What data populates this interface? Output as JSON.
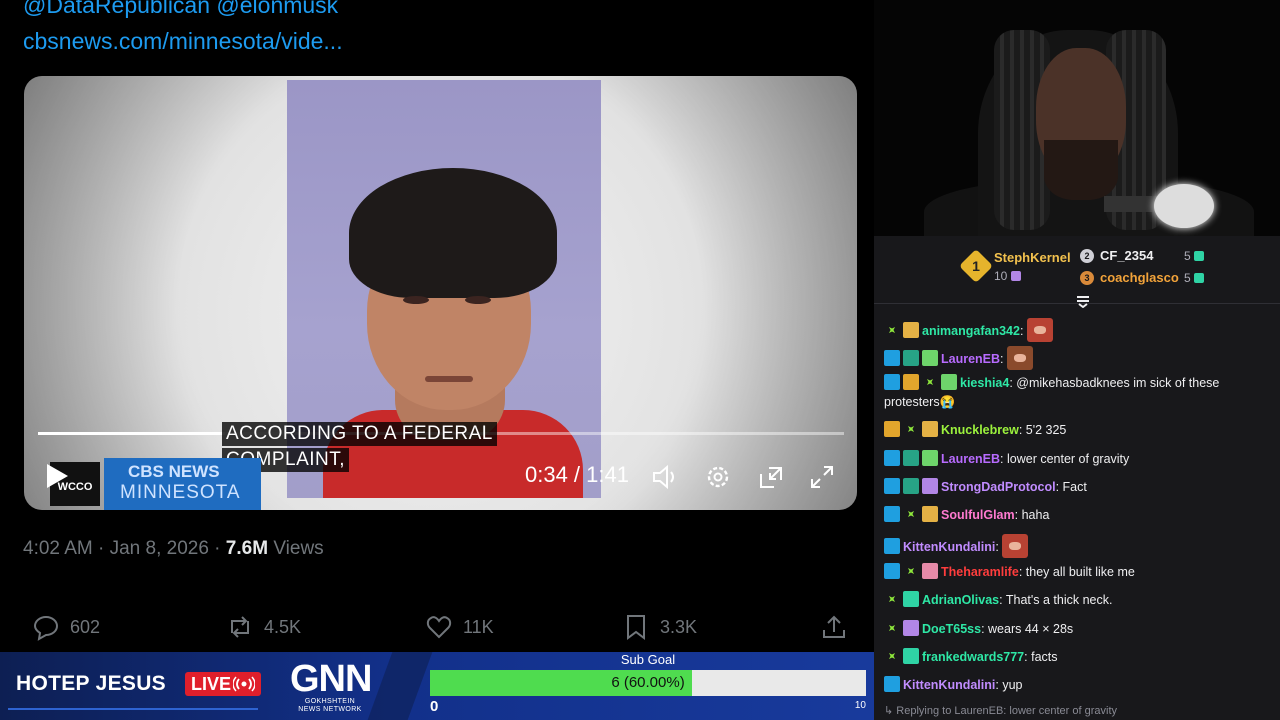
{
  "tweet": {
    "mentions": "@DataRepublican @elonmusk",
    "link": "cbsnews.com/minnesota/vide...",
    "video": {
      "caption_line1": "ACCORDING TO A FEDERAL",
      "caption_line2": "COMPLAINT,",
      "time_display": "0:34 / 1:41",
      "progress_fraction": 0.232,
      "station_logo": "WCCO",
      "network_line1": "CBS NEWS",
      "network_line2": "MINNESOTA"
    },
    "timestamp": "4:02 AM · Jan 8, 2026 · ",
    "views_count": "7.6M",
    "views_label": " Views",
    "actions": {
      "replies": "602",
      "reposts": "4.5K",
      "likes": "11K",
      "bookmarks": "3.3K"
    }
  },
  "chat": {
    "leaderboard": {
      "first": {
        "rank": "1",
        "name": "StephKernel",
        "count": "10"
      },
      "second": {
        "rank": "2",
        "name": "CF_2354",
        "count": "5"
      },
      "third": {
        "rank": "3",
        "name": "coachglasco",
        "count": "5"
      }
    },
    "messages": [
      {
        "user": "animangafan342",
        "color": "#2ee8a6",
        "text": ""
      },
      {
        "user": "LaurenEB",
        "color": "#b86bff",
        "text": ""
      },
      {
        "user": "kieshia4",
        "color": "#2ee8a6",
        "text": " @mikehasbadknees im sick of these protesters😭"
      },
      {
        "user": "Knucklebrew",
        "color": "#9cf23d",
        "text": " 5'2 325"
      },
      {
        "user": "LaurenEB",
        "color": "#b86bff",
        "text": " lower center of gravity"
      },
      {
        "user": "StrongDadProtocol",
        "color": "#c18cff",
        "text": " Fact"
      },
      {
        "user": "SoulfulGlam",
        "color": "#ff7ad0",
        "text": " haha"
      },
      {
        "user": "KittenKundalini",
        "color": "#c18cff",
        "text": ""
      },
      {
        "user": "Theharamlife",
        "color": "#ff3d3d",
        "text": " they all built like me"
      },
      {
        "user": "AdrianOlivas",
        "color": "#2ee8a6",
        "text": " That's a thick neck."
      },
      {
        "user": "DoeT65ss",
        "color": "#2ee8a6",
        "text": " wears 44 × 28s"
      },
      {
        "user": "frankedwards777",
        "color": "#2ee8a6",
        "text": " facts"
      },
      {
        "user": "KittenKundalini",
        "color": "#c18cff",
        "text": " yup"
      }
    ],
    "reply_hint": "Replying to LaurenEB: lower center of gravity"
  },
  "bottom_bar": {
    "show_title": "HOTEP JESUS",
    "live_label": "LIVE",
    "logo_main": "GNN",
    "logo_sub1": "GOKHSHTEIN",
    "logo_sub2": "NEWS NETWORK",
    "sub_goal": {
      "label": "Sub Goal",
      "value_text": "6 (60.00%)",
      "current": 6,
      "target": 10,
      "fraction": 0.6,
      "min_label": "0",
      "max_label": "10"
    }
  },
  "colors": {
    "accent_link": "#1d9bf0",
    "live_red": "#e01f2b",
    "goal_green": "#4fdc4f",
    "chat_bg": "#18181b"
  }
}
